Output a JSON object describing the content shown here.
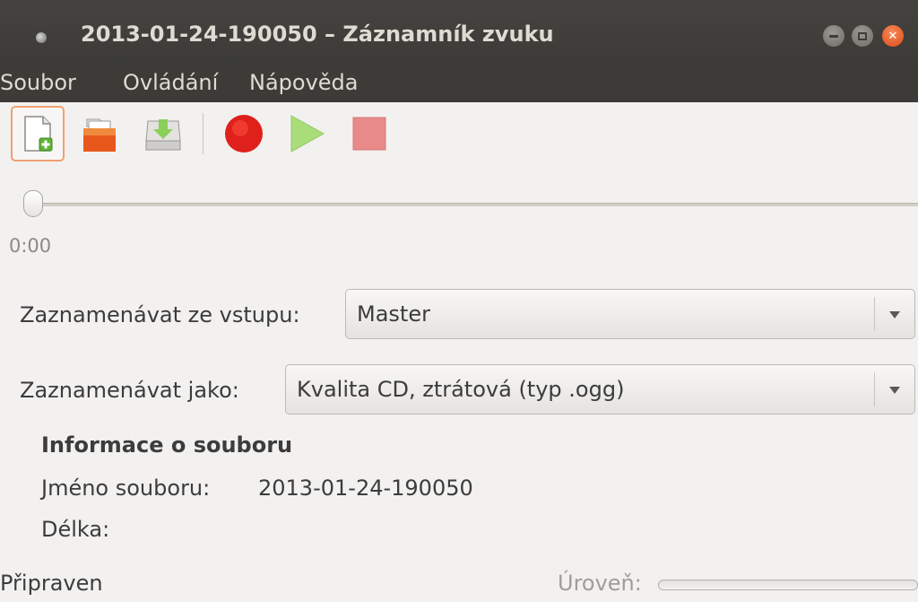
{
  "window": {
    "title": "2013-01-24-190050 – Záznamník zvuku"
  },
  "menu": {
    "items": [
      "Soubor",
      "Ovládání",
      "Nápověda"
    ]
  },
  "toolbar": {
    "buttons": [
      "new-icon",
      "open-icon",
      "save-icon",
      "record-icon",
      "play-icon",
      "stop-icon"
    ]
  },
  "playback": {
    "time": "0:00",
    "position": 0
  },
  "input": {
    "label": "Zaznamenávat ze vstupu:",
    "value": "Master"
  },
  "format": {
    "label": "Zaznamenávat jako:",
    "value": "Kvalita CD, ztrátová (typ .ogg)"
  },
  "file_info": {
    "heading": "Informace o souboru",
    "name_label": "Jméno souboru:",
    "name_value": "2013-01-24-190050",
    "length_label": "Délka:",
    "length_value": ""
  },
  "status": {
    "text": "Připraven",
    "level_label": "Úroveň:",
    "level": 0
  },
  "colors": {
    "titlebar": "#3c3b37",
    "close_button": "#df4a16",
    "record": "#e0201a",
    "play": "#a9dd7a",
    "stop": "#e88a8a"
  }
}
